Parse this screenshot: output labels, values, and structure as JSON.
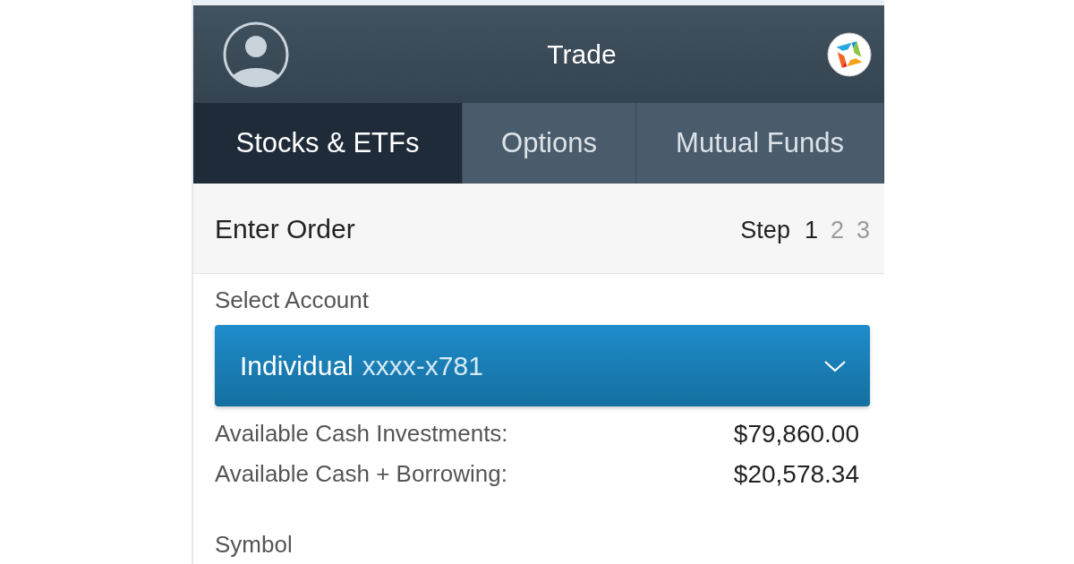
{
  "header": {
    "title": "Trade"
  },
  "tabs": [
    {
      "label": "Stocks & ETFs",
      "selected": true
    },
    {
      "label": "Options",
      "selected": false
    },
    {
      "label": "Mutual Funds",
      "selected": false
    }
  ],
  "order_header": {
    "title": "Enter Order",
    "step_label": "Step",
    "steps": [
      {
        "label": "1",
        "selected": true
      },
      {
        "label": "2",
        "selected": false
      },
      {
        "label": "3",
        "selected": false
      }
    ]
  },
  "account": {
    "label": "Select Account",
    "name": "Individual",
    "number": "xxxx-x781"
  },
  "balances": [
    {
      "label": "Available Cash Investments:",
      "value": "$79,860.00"
    },
    {
      "label": "Available Cash + Borrowing:",
      "value": "$20,578.34"
    }
  ],
  "symbol": {
    "label": "Symbol"
  }
}
